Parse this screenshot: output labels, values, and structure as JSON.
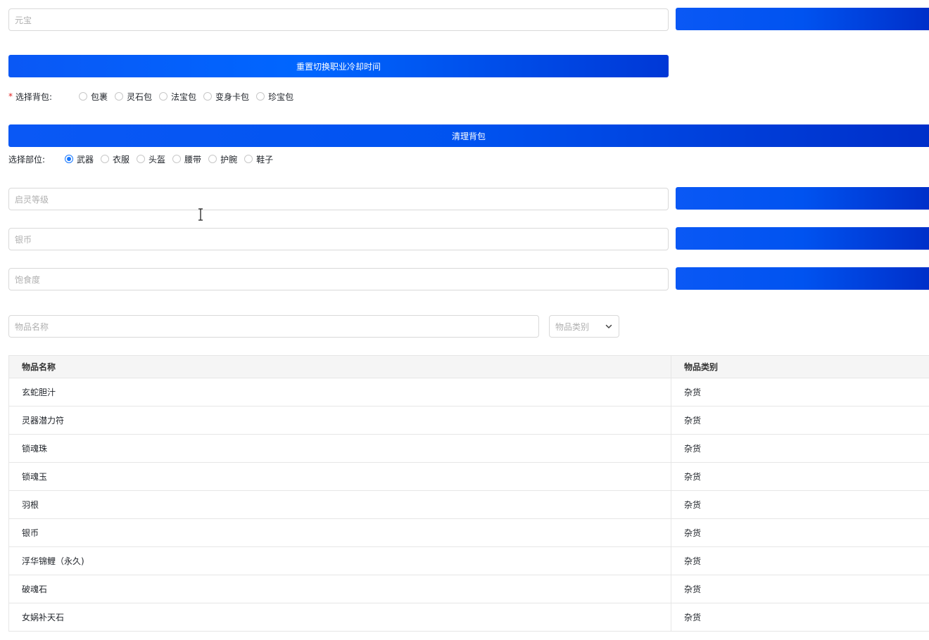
{
  "ingot": {
    "placeholder": "元宝"
  },
  "reset_cooldown_button": "重置切换职业冷却时间",
  "bag": {
    "label": "选择背包:",
    "options": [
      "包裹",
      "灵石包",
      "法宝包",
      "变身卡包",
      "珍宝包"
    ],
    "selected": null
  },
  "clear_bag_button": "清理背包",
  "slot": {
    "label": "选择部位:",
    "options": [
      "武器",
      "衣服",
      "头盔",
      "腰带",
      "护腕",
      "鞋子"
    ],
    "selected": "武器"
  },
  "spirit_level": {
    "placeholder": "启灵等级"
  },
  "silver": {
    "placeholder": "银币"
  },
  "satiety": {
    "placeholder": "饱食度"
  },
  "search": {
    "name_placeholder": "物品名称",
    "category_placeholder": "物品类别"
  },
  "table": {
    "headers": [
      "物品名称",
      "物品类别"
    ],
    "rows": [
      [
        "玄蛇胆汁",
        "杂货"
      ],
      [
        "灵器潜力符",
        "杂货"
      ],
      [
        "锁魂珠",
        "杂货"
      ],
      [
        "锁魂玉",
        "杂货"
      ],
      [
        "羽根",
        "杂货"
      ],
      [
        "银币",
        "杂货"
      ],
      [
        "浮华锦鲤（永久)",
        "杂货"
      ],
      [
        "破魂石",
        "杂货"
      ],
      [
        "女娲补天石",
        "杂货"
      ]
    ]
  },
  "colors": {
    "primary_button": "#0a58f5",
    "radio_checked": "#1677ff",
    "required_asterisk": "#e02020"
  }
}
